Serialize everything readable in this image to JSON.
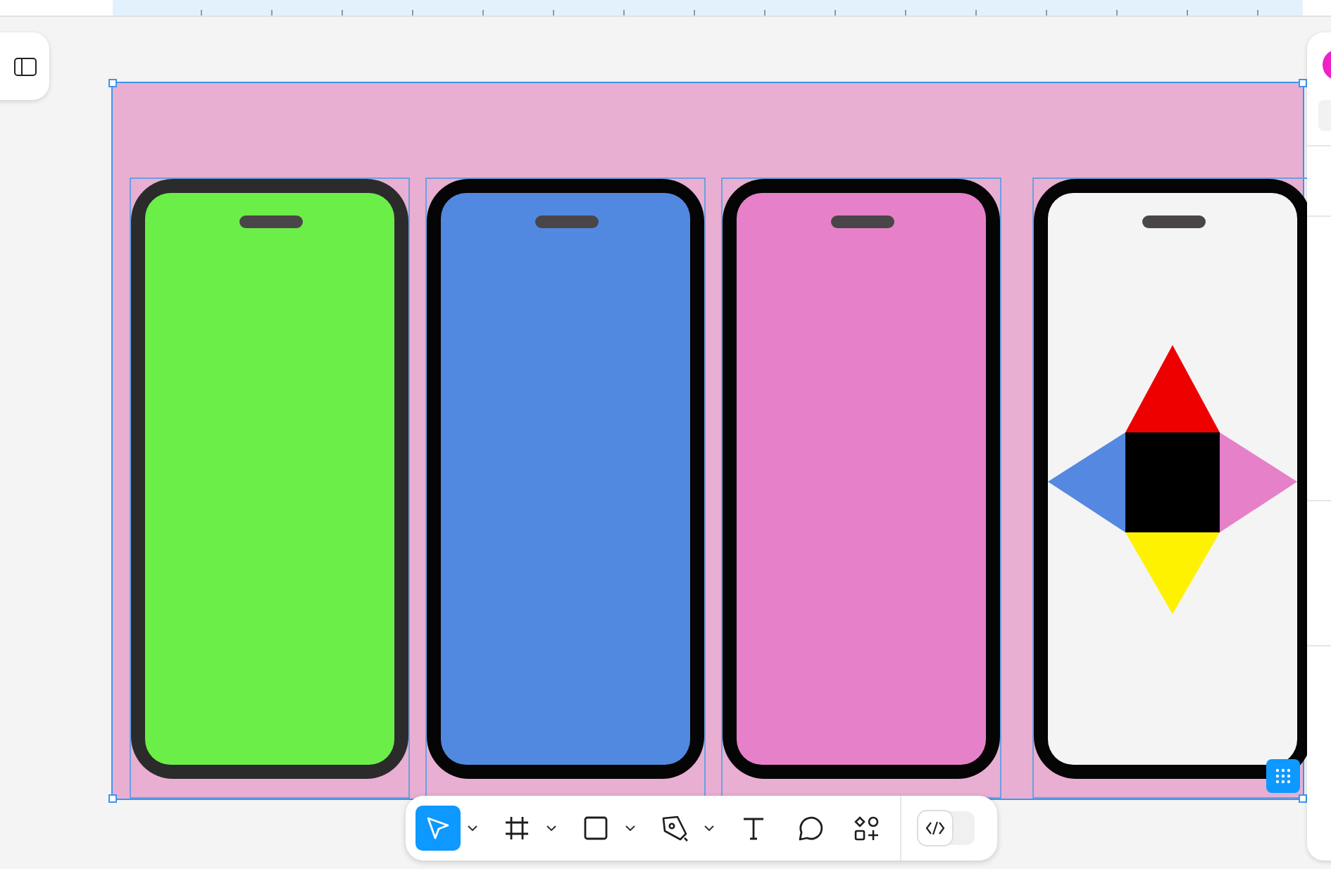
{
  "frame": {
    "selected": true
  },
  "phones": [
    {
      "kind": "blank",
      "color": "#6bee48",
      "bezel": {
        "color": "#2b2b2b"
      }
    },
    {
      "kind": "blank",
      "color": "#5289e0",
      "bezel": {
        "color": "#050505"
      }
    },
    {
      "kind": "blank",
      "color": "#e681c9",
      "bezel": {
        "color": "#050505"
      }
    },
    {
      "kind": "shapes",
      "color": "#f4f4f4",
      "bezel": {
        "color": "#050505"
      }
    }
  ],
  "toolbar": {
    "tools": [
      {
        "kind": "move",
        "selected": true,
        "caret": true
      },
      {
        "kind": "frame",
        "selected": false,
        "caret": true
      },
      {
        "kind": "rectangle",
        "selected": false,
        "caret": true
      },
      {
        "kind": "pen",
        "selected": false,
        "caret": true
      },
      {
        "kind": "text",
        "selected": false,
        "caret": false
      },
      {
        "kind": "comment",
        "selected": false,
        "caret": false
      },
      {
        "kind": "components",
        "selected": false,
        "caret": false
      }
    ],
    "dev_mode": {
      "on": false
    }
  }
}
